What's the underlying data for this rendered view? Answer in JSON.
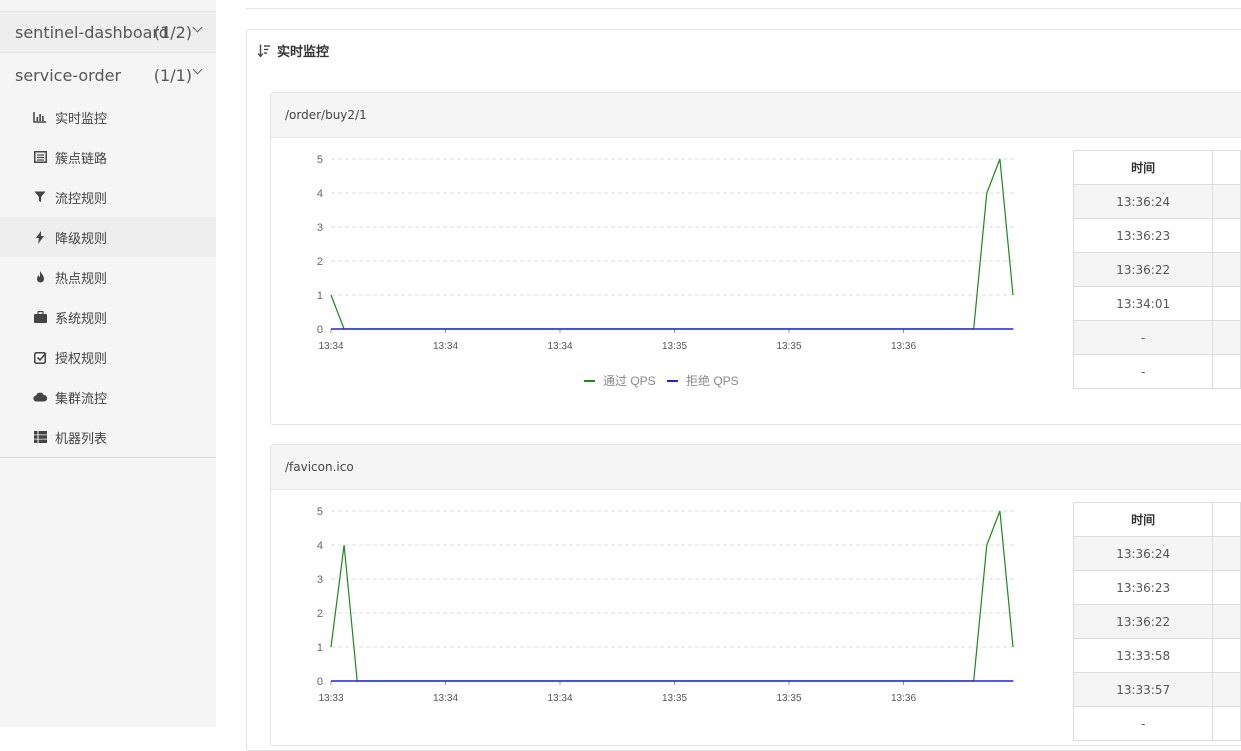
{
  "sidebar": {
    "apps": [
      {
        "name": "sentinel-dashboard",
        "count": "(1/2)"
      },
      {
        "name": "service-order",
        "count": "(1/1)"
      }
    ],
    "menu": [
      {
        "label": "实时监控",
        "icon": "bar-chart-icon"
      },
      {
        "label": "簇点链路",
        "icon": "list-icon"
      },
      {
        "label": "流控规则",
        "icon": "filter-icon"
      },
      {
        "label": "降级规则",
        "icon": "flash-icon"
      },
      {
        "label": "热点规则",
        "icon": "fire-icon"
      },
      {
        "label": "系统规则",
        "icon": "briefcase-icon"
      },
      {
        "label": "授权规则",
        "icon": "check-square-icon"
      },
      {
        "label": "集群流控",
        "icon": "cloud-icon"
      },
      {
        "label": "机器列表",
        "icon": "th-list-icon"
      }
    ]
  },
  "main": {
    "title": "实时监控",
    "legend": {
      "pass": "通过 QPS",
      "block": "拒绝 QPS"
    },
    "colors": {
      "pass": "#1a8a1a",
      "block": "#2222dd"
    },
    "resources": [
      {
        "name": "/order/buy2/1",
        "table_header": "时间",
        "table_rows": [
          "13:36:24",
          "13:36:23",
          "13:36:22",
          "13:34:01",
          "-",
          "-"
        ],
        "chart_data": {
          "type": "line",
          "yticks": [
            0,
            1,
            2,
            3,
            4,
            5
          ],
          "ylim": [
            0,
            5
          ],
          "xticks": [
            "13:34",
            "13:34",
            "13:34",
            "13:35",
            "13:35",
            "13:36"
          ],
          "series": [
            {
              "name": "通过 QPS",
              "values": [
                1,
                0,
                0,
                0,
                0,
                0,
                0,
                0,
                0,
                0,
                0,
                0,
                0,
                0,
                0,
                0,
                0,
                0,
                0,
                0,
                0,
                0,
                0,
                0,
                0,
                0,
                0,
                0,
                0,
                0,
                0,
                0,
                0,
                0,
                0,
                0,
                0,
                0,
                0,
                0,
                0,
                0,
                0,
                0,
                0,
                0,
                0,
                0,
                0,
                0,
                4,
                5,
                1
              ]
            },
            {
              "name": "拒绝 QPS",
              "values": [
                0,
                0,
                0,
                0,
                0,
                0,
                0,
                0,
                0,
                0,
                0,
                0,
                0,
                0,
                0,
                0,
                0,
                0,
                0,
                0,
                0,
                0,
                0,
                0,
                0,
                0,
                0,
                0,
                0,
                0,
                0,
                0,
                0,
                0,
                0,
                0,
                0,
                0,
                0,
                0,
                0,
                0,
                0,
                0,
                0,
                0,
                0,
                0,
                0,
                0,
                0,
                0,
                0
              ]
            }
          ]
        }
      },
      {
        "name": "/favicon.ico",
        "table_header": "时间",
        "table_rows": [
          "13:36:24",
          "13:36:23",
          "13:36:22",
          "13:33:58",
          "13:33:57",
          "-"
        ],
        "chart_data": {
          "type": "line",
          "yticks": [
            0,
            1,
            2,
            3,
            4,
            5
          ],
          "ylim": [
            0,
            5
          ],
          "xticks": [
            "13:33",
            "13:34",
            "13:34",
            "13:35",
            "13:35",
            "13:36"
          ],
          "series": [
            {
              "name": "通过 QPS",
              "values": [
                1,
                4,
                0,
                0,
                0,
                0,
                0,
                0,
                0,
                0,
                0,
                0,
                0,
                0,
                0,
                0,
                0,
                0,
                0,
                0,
                0,
                0,
                0,
                0,
                0,
                0,
                0,
                0,
                0,
                0,
                0,
                0,
                0,
                0,
                0,
                0,
                0,
                0,
                0,
                0,
                0,
                0,
                0,
                0,
                0,
                0,
                0,
                0,
                0,
                0,
                4,
                5,
                1
              ]
            },
            {
              "name": "拒绝 QPS",
              "values": [
                0,
                0,
                0,
                0,
                0,
                0,
                0,
                0,
                0,
                0,
                0,
                0,
                0,
                0,
                0,
                0,
                0,
                0,
                0,
                0,
                0,
                0,
                0,
                0,
                0,
                0,
                0,
                0,
                0,
                0,
                0,
                0,
                0,
                0,
                0,
                0,
                0,
                0,
                0,
                0,
                0,
                0,
                0,
                0,
                0,
                0,
                0,
                0,
                0,
                0,
                0,
                0,
                0
              ]
            }
          ]
        }
      }
    ]
  }
}
